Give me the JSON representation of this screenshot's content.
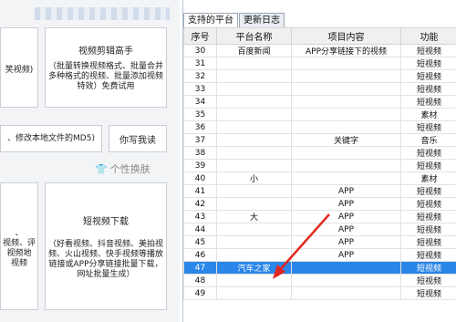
{
  "left": {
    "cards": [
      {
        "title": "",
        "sub": "笑视频)"
      },
      {
        "title": "视频剪辑高手",
        "sub": "（批量转换视频格式、批量合并多种格式的视频、批量添加视频特效）免费试用"
      },
      {
        "title": "",
        "sub": "、修改本地文件的MD5)"
      },
      {
        "title": "你写我读",
        "sub": ""
      },
      {
        "title": "",
        "sub": "、\n视频、评\n视频地\n视频"
      },
      {
        "title": "短视频下载",
        "sub": "（好看视频、抖音视频、美拍视频、火山视频、快手视频等播放链接或APP分享链接批量下载，网址批量生成）"
      }
    ],
    "skin_label": "个性换肤"
  },
  "tabs": [
    "支持的平台",
    "更新日志"
  ],
  "table": {
    "headers": [
      "序号",
      "平台名称",
      "项目内容",
      "功能"
    ],
    "rows": [
      {
        "no": "30",
        "name": "百度新闻",
        "content": "APP分享链接下的视频",
        "func": "短视频"
      },
      {
        "no": "31",
        "name": "",
        "content": "",
        "func": "短视频"
      },
      {
        "no": "32",
        "name": "",
        "content": "",
        "func": "短视频"
      },
      {
        "no": "33",
        "name": "",
        "content": "",
        "func": "短视频"
      },
      {
        "no": "34",
        "name": "",
        "content": "",
        "func": "短视频"
      },
      {
        "no": "35",
        "name": "",
        "content": "",
        "func": "素材"
      },
      {
        "no": "36",
        "name": "",
        "content": "",
        "func": "短视频"
      },
      {
        "no": "37",
        "name": "",
        "content": "关键字",
        "func": "音乐"
      },
      {
        "no": "38",
        "name": "",
        "content": "",
        "func": "短视频"
      },
      {
        "no": "39",
        "name": "",
        "content": "",
        "func": "短视频"
      },
      {
        "no": "40",
        "name": "小",
        "content": "",
        "func": "素材"
      },
      {
        "no": "41",
        "name": "",
        "content": "APP",
        "func": "短视频"
      },
      {
        "no": "42",
        "name": "",
        "content": "APP",
        "func": "短视频"
      },
      {
        "no": "43",
        "name": "大",
        "content": "APP",
        "func": "短视频"
      },
      {
        "no": "44",
        "name": "",
        "content": "APP",
        "func": "短视频"
      },
      {
        "no": "45",
        "name": "",
        "content": "APP",
        "func": "短视频"
      },
      {
        "no": "46",
        "name": "",
        "content": "APP",
        "func": "短视频"
      },
      {
        "no": "47",
        "name": "汽车之家",
        "content": "",
        "func": "短视频"
      },
      {
        "no": "48",
        "name": "",
        "content": "",
        "func": "短视频"
      },
      {
        "no": "49",
        "name": "",
        "content": "",
        "func": "短视频"
      }
    ],
    "selected_index": 17
  }
}
